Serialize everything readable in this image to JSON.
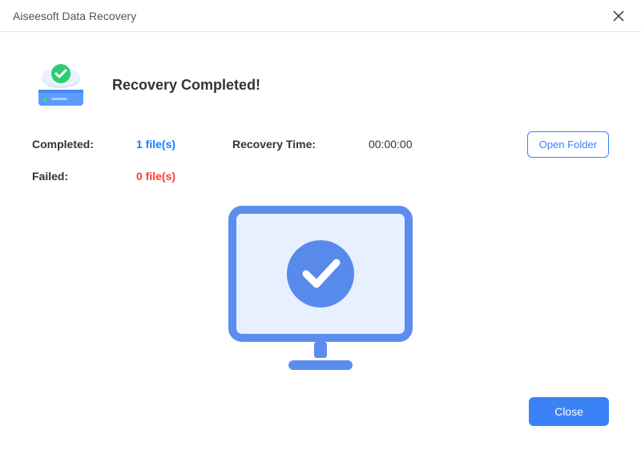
{
  "titlebar": {
    "title": "Aiseesoft Data Recovery"
  },
  "heading": "Recovery Completed!",
  "stats": {
    "completed_label": "Completed:",
    "completed_value": "1 file(s)",
    "failed_label": "Failed:",
    "failed_value": "0 file(s)",
    "recovery_time_label": "Recovery Time:",
    "recovery_time_value": "00:00:00"
  },
  "buttons": {
    "open_folder": "Open Folder",
    "close": "Close"
  },
  "colors": {
    "primary": "#3b82f6",
    "success": "#1a7cff",
    "error": "#ff3b30"
  }
}
